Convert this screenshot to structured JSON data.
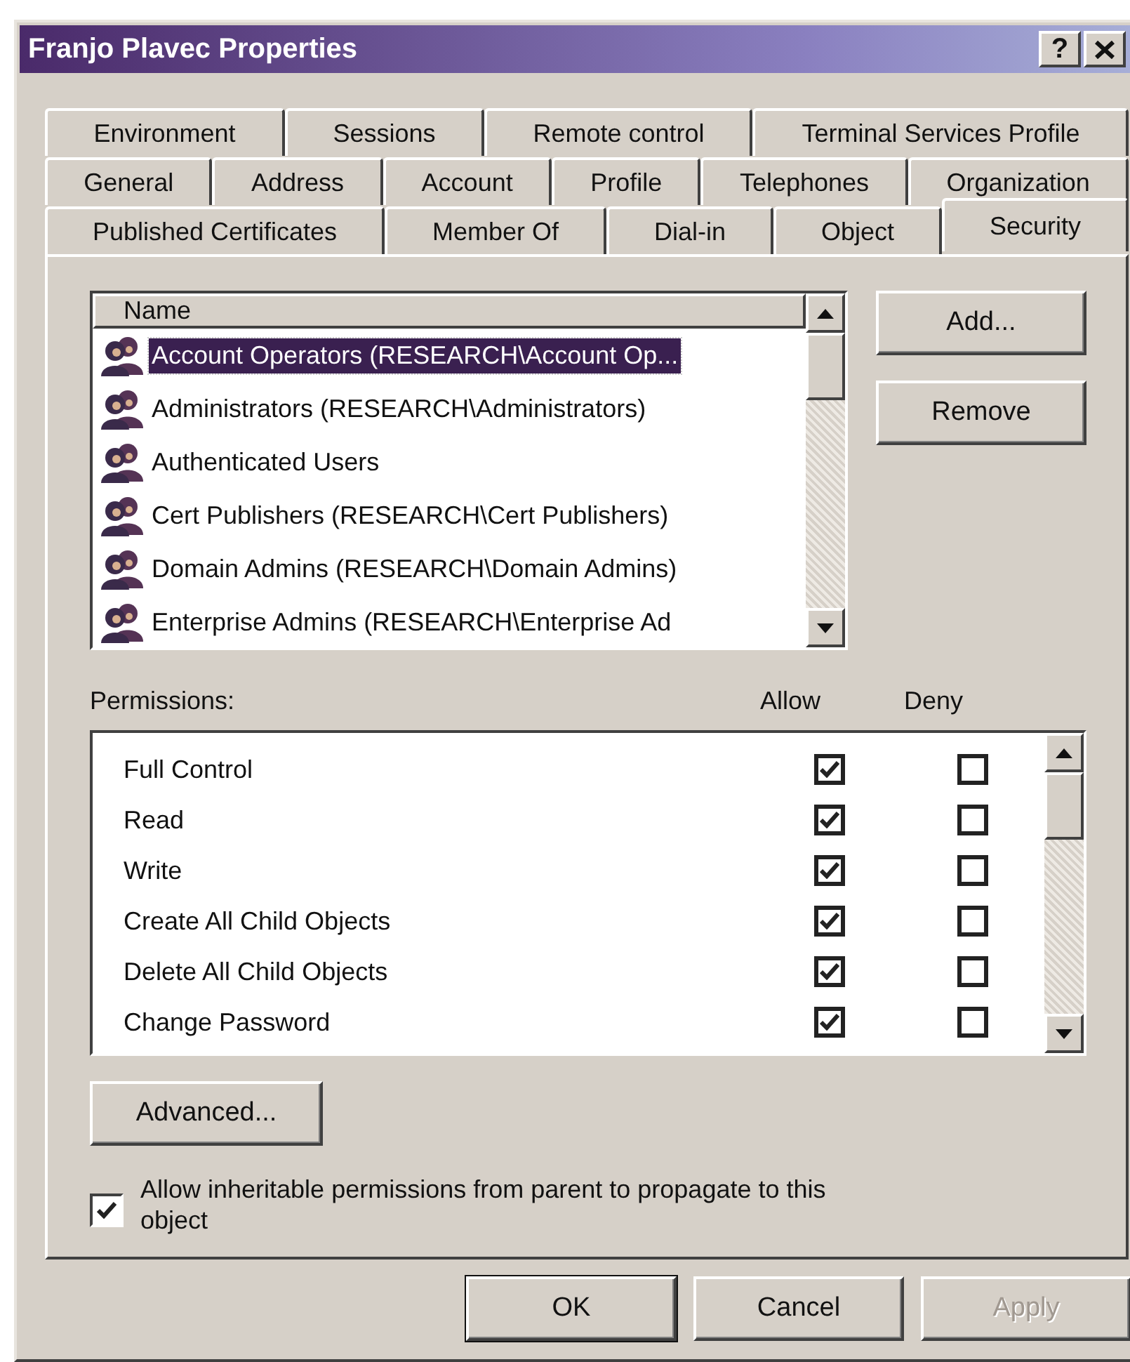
{
  "window": {
    "title": "Franjo Plavec Properties",
    "help_button": "?"
  },
  "tab_rows": [
    [
      {
        "label": "Environment",
        "selected": false
      },
      {
        "label": "Sessions",
        "selected": false
      },
      {
        "label": "Remote control",
        "selected": false
      },
      {
        "label": "Terminal Services Profile",
        "selected": false
      }
    ],
    [
      {
        "label": "General",
        "selected": false
      },
      {
        "label": "Address",
        "selected": false
      },
      {
        "label": "Account",
        "selected": false
      },
      {
        "label": "Profile",
        "selected": false
      },
      {
        "label": "Telephones",
        "selected": false
      },
      {
        "label": "Organization",
        "selected": false
      }
    ],
    [
      {
        "label": "Published Certificates",
        "selected": false
      },
      {
        "label": "Member Of",
        "selected": false
      },
      {
        "label": "Dial-in",
        "selected": false
      },
      {
        "label": "Object",
        "selected": false
      },
      {
        "label": "Security",
        "selected": true
      }
    ]
  ],
  "names_list": {
    "column": "Name",
    "items": [
      {
        "name": "Account Operators (RESEARCH\\Account Op...",
        "selected": true
      },
      {
        "name": "Administrators (RESEARCH\\Administrators)",
        "selected": false
      },
      {
        "name": "Authenticated Users",
        "selected": false
      },
      {
        "name": "Cert Publishers (RESEARCH\\Cert Publishers)",
        "selected": false
      },
      {
        "name": "Domain Admins (RESEARCH\\Domain Admins)",
        "selected": false
      },
      {
        "name": "Enterprise Admins (RESEARCH\\Enterprise Ad",
        "selected": false
      }
    ]
  },
  "side_buttons": [
    {
      "label": "Add...",
      "disabled": false
    },
    {
      "label": "Remove",
      "disabled": false
    }
  ],
  "permissions": {
    "label": "Permissions:",
    "allow_header": "Allow",
    "deny_header": "Deny",
    "rows": [
      {
        "name": "Full Control",
        "allow": true,
        "deny": false
      },
      {
        "name": "Read",
        "allow": true,
        "deny": false
      },
      {
        "name": "Write",
        "allow": true,
        "deny": false
      },
      {
        "name": "Create All Child Objects",
        "allow": true,
        "deny": false
      },
      {
        "name": "Delete All Child Objects",
        "allow": true,
        "deny": false
      },
      {
        "name": "Change Password",
        "allow": true,
        "deny": false
      }
    ]
  },
  "advanced_button": "Advanced...",
  "inherit": {
    "label": "Allow inheritable permissions from parent to propagate to this object",
    "checked": true
  },
  "footer_buttons": [
    {
      "label": "OK",
      "disabled": false
    },
    {
      "label": "Cancel",
      "disabled": false
    },
    {
      "label": "Apply",
      "disabled": true
    }
  ]
}
